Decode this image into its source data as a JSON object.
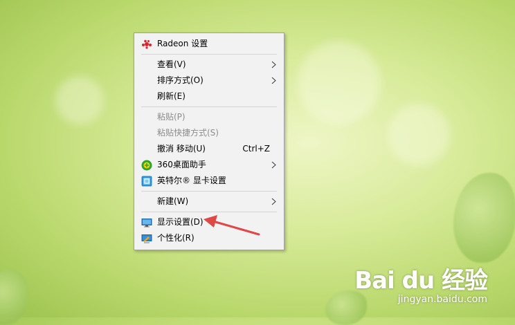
{
  "menu": {
    "items": [
      {
        "label": "Radeon 设置",
        "icon": "radeon-icon"
      },
      {
        "label": "查看(V)",
        "submenu": true
      },
      {
        "label": "排序方式(O)",
        "submenu": true
      },
      {
        "label": "刷新(E)"
      },
      {
        "label": "粘贴(P)",
        "disabled": true
      },
      {
        "label": "粘贴快捷方式(S)",
        "disabled": true
      },
      {
        "label": "撤消 移动(U)",
        "shortcut": "Ctrl+Z"
      },
      {
        "label": "360桌面助手",
        "icon": "360-icon",
        "submenu": true
      },
      {
        "label": "英特尔® 显卡设置",
        "icon": "intel-graphics-icon"
      },
      {
        "label": "新建(W)",
        "submenu": true
      },
      {
        "label": "显示设置(D)",
        "icon": "display-icon"
      },
      {
        "label": "个性化(R)",
        "icon": "personalize-icon"
      }
    ]
  },
  "watermark": {
    "brand": "Bai du 经验",
    "url": "jingyan.baidu.com"
  },
  "colors": {
    "arrow": "#e04848",
    "menu_bg": "#f2f2f2"
  }
}
